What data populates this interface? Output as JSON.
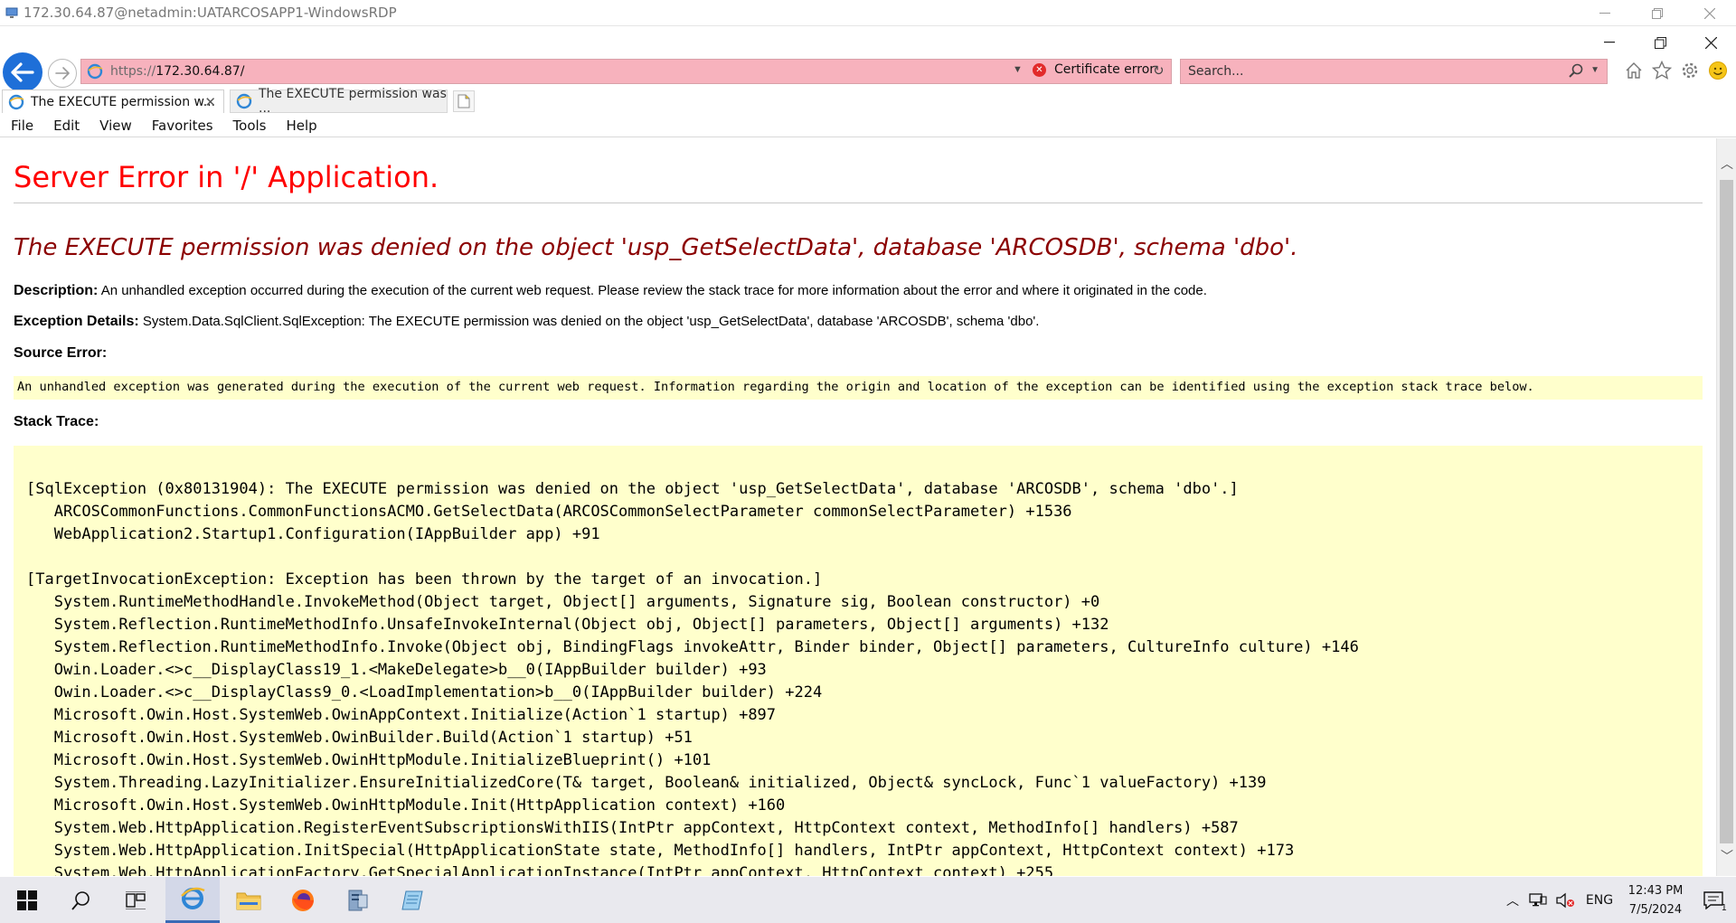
{
  "rdp": {
    "title": "172.30.64.87@netadmin:UATARCOSAPP1-WindowsRDP"
  },
  "browser": {
    "url_prefix": "https://",
    "url_host": "172.30.64.87/",
    "cert_error_label": "Certificate error",
    "search_placeholder": "Search...",
    "tabs": [
      {
        "label": "The EXECUTE permission w..."
      },
      {
        "label": "The EXECUTE permission was ..."
      }
    ],
    "menu": [
      "File",
      "Edit",
      "View",
      "Favorites",
      "Tools",
      "Help"
    ]
  },
  "page": {
    "server_error_heading": "Server Error in '/' Application.",
    "error_title": "The EXECUTE permission was denied on the object 'usp_GetSelectData', database 'ARCOSDB', schema 'dbo'.",
    "description_label": "Description:",
    "description_text": "An unhandled exception occurred during the execution of the current web request. Please review the stack trace for more information about the error and where it originated in the code.",
    "exception_label": "Exception Details:",
    "exception_text": "System.Data.SqlClient.SqlException: The EXECUTE permission was denied on the object 'usp_GetSelectData', database 'ARCOSDB', schema 'dbo'.",
    "source_error_label": "Source Error:",
    "source_error_text": "An unhandled exception was generated during the execution of the current web request. Information regarding the origin and location of the exception can be identified using the exception stack trace below.",
    "stack_trace_label": "Stack Trace:",
    "stack_trace": "[SqlException (0x80131904): The EXECUTE permission was denied on the object 'usp_GetSelectData', database 'ARCOSDB', schema 'dbo'.]\n   ARCOSCommonFunctions.CommonFunctionsACMO.GetSelectData(ARCOSCommonSelectParameter commonSelectParameter) +1536\n   WebApplication2.Startup1.Configuration(IAppBuilder app) +91\n\n[TargetInvocationException: Exception has been thrown by the target of an invocation.]\n   System.RuntimeMethodHandle.InvokeMethod(Object target, Object[] arguments, Signature sig, Boolean constructor) +0\n   System.Reflection.RuntimeMethodInfo.UnsafeInvokeInternal(Object obj, Object[] parameters, Object[] arguments) +132\n   System.Reflection.RuntimeMethodInfo.Invoke(Object obj, BindingFlags invokeAttr, Binder binder, Object[] parameters, CultureInfo culture) +146\n   Owin.Loader.<>c__DisplayClass19_1.<MakeDelegate>b__0(IAppBuilder builder) +93\n   Owin.Loader.<>c__DisplayClass9_0.<LoadImplementation>b__0(IAppBuilder builder) +224\n   Microsoft.Owin.Host.SystemWeb.OwinAppContext.Initialize(Action`1 startup) +897\n   Microsoft.Owin.Host.SystemWeb.OwinBuilder.Build(Action`1 startup) +51\n   Microsoft.Owin.Host.SystemWeb.OwinHttpModule.InitializeBlueprint() +101\n   System.Threading.LazyInitializer.EnsureInitializedCore(T& target, Boolean& initialized, Object& syncLock, Func`1 valueFactory) +139\n   Microsoft.Owin.Host.SystemWeb.OwinHttpModule.Init(HttpApplication context) +160\n   System.Web.HttpApplication.RegisterEventSubscriptionsWithIIS(IntPtr appContext, HttpContext context, MethodInfo[] handlers) +587\n   System.Web.HttpApplication.InitSpecial(HttpApplicationState state, MethodInfo[] handlers, IntPtr appContext, HttpContext context) +173\n   System.Web.HttpApplicationFactory.GetSpecialApplicationInstance(IntPtr appContext, HttpContext context) +255"
  },
  "taskbar": {
    "language": "ENG",
    "time": "12:43 PM",
    "date": "7/5/2024",
    "notification_count": "1"
  },
  "colors": {
    "address_error_bg": "#f7b2bd",
    "heading_red": "#ff0000",
    "title_darkred": "#8b0000",
    "code_bg": "#ffffcc",
    "back_button_blue": "#1e6fd8"
  }
}
